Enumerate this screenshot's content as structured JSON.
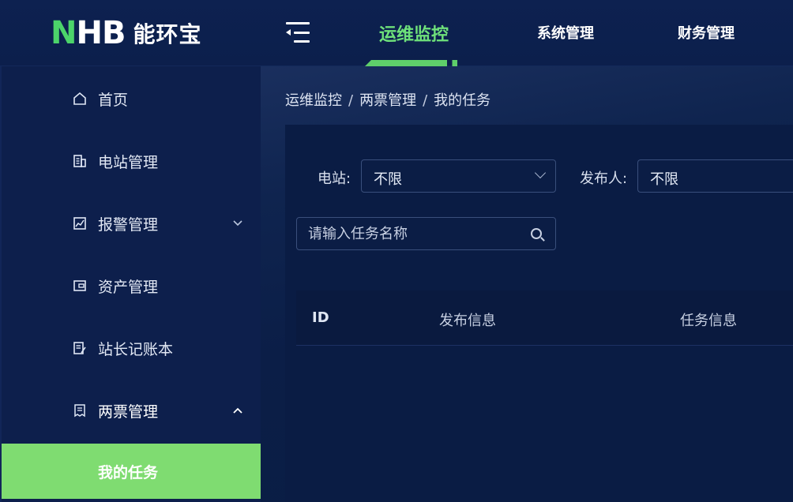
{
  "brand": {
    "logo_letters": "HB",
    "logo_n": "N",
    "name_cn": "能环宝"
  },
  "topnav": {
    "tabs": [
      {
        "label": "运维监控",
        "active": true
      },
      {
        "label": "系统管理",
        "active": false
      },
      {
        "label": "财务管理",
        "active": false
      }
    ]
  },
  "sidebar": {
    "items": [
      {
        "label": "首页",
        "icon": "home-icon"
      },
      {
        "label": "电站管理",
        "icon": "building-icon"
      },
      {
        "label": "报警管理",
        "icon": "chart-alarm-icon",
        "chevron": "down"
      },
      {
        "label": "资产管理",
        "icon": "wallet-icon"
      },
      {
        "label": "站长记账本",
        "icon": "notebook-icon"
      },
      {
        "label": "两票管理",
        "icon": "ticket-icon",
        "chevron": "up"
      }
    ],
    "sub_item": {
      "label": "我的任务"
    }
  },
  "breadcrumb": {
    "items": [
      "运维监控",
      "两票管理",
      "我的任务"
    ],
    "separator": "/"
  },
  "filters": {
    "station_label": "电站:",
    "station_value": "不限",
    "publisher_label": "发布人:",
    "publisher_value": "不限",
    "search_placeholder": "请输入任务名称"
  },
  "table": {
    "columns": [
      "ID",
      "发布信息",
      "任务信息"
    ]
  },
  "colors": {
    "accent": "#6ee07a",
    "active_item_bg": "#7fdc71",
    "background": "#0c1e47"
  }
}
